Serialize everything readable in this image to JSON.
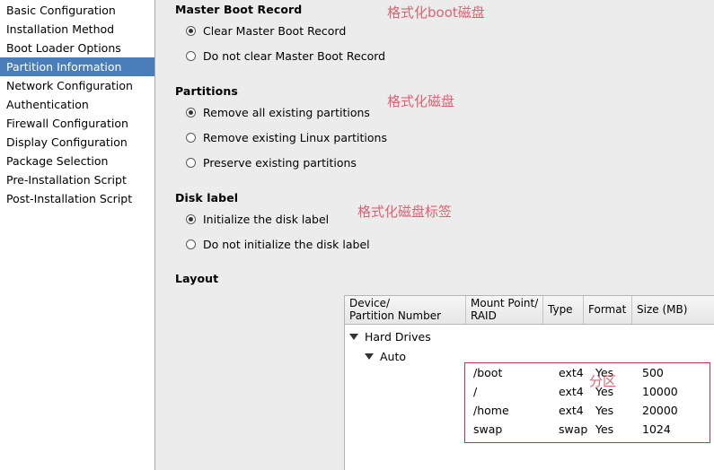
{
  "sidebar": {
    "items": [
      {
        "label": "Basic Configuration",
        "selected": false
      },
      {
        "label": "Installation Method",
        "selected": false
      },
      {
        "label": "Boot Loader Options",
        "selected": false
      },
      {
        "label": "Partition Information",
        "selected": true
      },
      {
        "label": "Network Configuration",
        "selected": false
      },
      {
        "label": "Authentication",
        "selected": false
      },
      {
        "label": "Firewall Configuration",
        "selected": false
      },
      {
        "label": "Display Configuration",
        "selected": false
      },
      {
        "label": "Package Selection",
        "selected": false
      },
      {
        "label": "Pre-Installation Script",
        "selected": false
      },
      {
        "label": "Post-Installation Script",
        "selected": false
      }
    ]
  },
  "main": {
    "mbr": {
      "title": "Master Boot Record",
      "options": [
        {
          "label": "Clear Master Boot Record",
          "selected": true
        },
        {
          "label": "Do not clear Master Boot Record",
          "selected": false
        }
      ]
    },
    "partitions": {
      "title": "Partitions",
      "options": [
        {
          "label": "Remove all existing partitions",
          "selected": true
        },
        {
          "label": "Remove existing Linux partitions",
          "selected": false
        },
        {
          "label": "Preserve existing partitions",
          "selected": false
        }
      ]
    },
    "disk_label": {
      "title": "Disk label",
      "options": [
        {
          "label": "Initialize the disk label",
          "selected": true
        },
        {
          "label": "Do not initialize the disk label",
          "selected": false
        }
      ]
    },
    "layout": {
      "title": "Layout",
      "columns": [
        {
          "line1": "Device/",
          "line2": "Partition Number"
        },
        {
          "line1": "Mount Point/",
          "line2": "RAID"
        },
        {
          "line1": "Type",
          "line2": ""
        },
        {
          "line1": "Format",
          "line2": ""
        },
        {
          "line1": "Size (MB)",
          "line2": ""
        }
      ],
      "tree": [
        {
          "label": "Hard Drives"
        },
        {
          "label": "Auto"
        }
      ],
      "partition_rows": [
        {
          "mount": "/boot",
          "type": "ext4",
          "format": "Yes",
          "size": "500"
        },
        {
          "mount": "/",
          "type": "ext4",
          "format": "Yes",
          "size": "10000"
        },
        {
          "mount": "/home",
          "type": "ext4",
          "format": "Yes",
          "size": "20000"
        },
        {
          "mount": "swap",
          "type": "swap",
          "format": "Yes",
          "size": "1024"
        }
      ]
    }
  },
  "annotations": [
    {
      "text": "格式化boot磁盘"
    },
    {
      "text": "格式化磁盘"
    },
    {
      "text": "格式化磁盘标签"
    },
    {
      "text": "分区"
    }
  ],
  "colors": {
    "selection_blue": "#4a7ebb",
    "annotation_red": "#d94a5a",
    "highlight_box_red": "#c0344a",
    "background_gray": "#ececec"
  }
}
